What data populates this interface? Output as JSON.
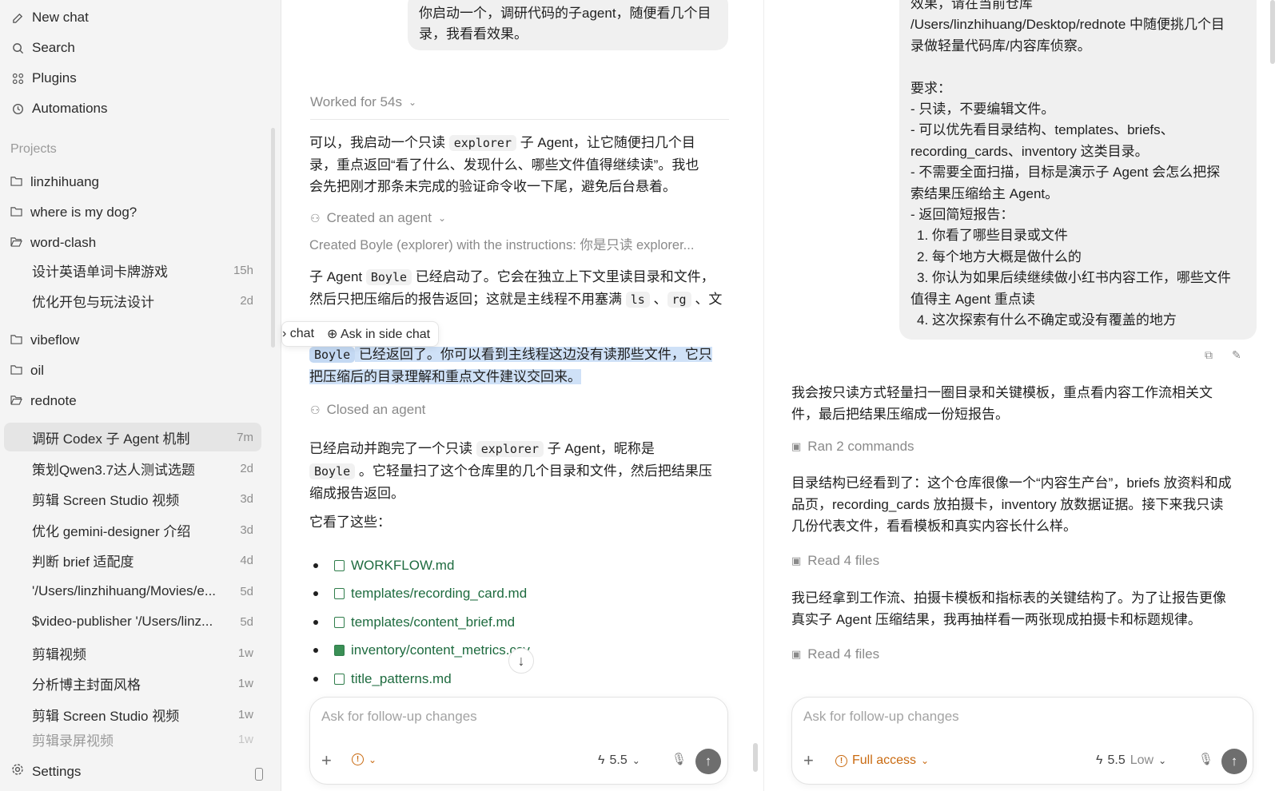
{
  "sidebar": {
    "nav": [
      {
        "label": "New chat",
        "icon": "compose-icon"
      },
      {
        "label": "Search",
        "icon": "search-icon"
      },
      {
        "label": "Plugins",
        "icon": "plugins-icon"
      },
      {
        "label": "Automations",
        "icon": "clock-icon"
      }
    ],
    "projects_label": "Projects",
    "projects": [
      "linzhihuang",
      "where is my dog?",
      "word-clash",
      "vibeflow",
      "oil",
      "rednote"
    ],
    "word_clash_threads": [
      {
        "title": "设计英语单词卡牌游戏",
        "age": "15h"
      },
      {
        "title": "优化开包与玩法设计",
        "age": "2d"
      }
    ],
    "rednote_threads": [
      {
        "title": "调研 Codex 子 Agent 机制",
        "age": "7m"
      },
      {
        "title": "策划Qwen3.7达人测试选题",
        "age": "2d"
      },
      {
        "title": "剪辑 Screen Studio 视频",
        "age": "3d"
      },
      {
        "title": "优化 gemini-designer 介绍",
        "age": "3d"
      },
      {
        "title": "判断 brief 适配度",
        "age": "4d"
      },
      {
        "title": "'/Users/linzhihuang/Movies/e...",
        "age": "5d"
      },
      {
        "title": "$video-publisher '/Users/linz...",
        "age": "5d"
      },
      {
        "title": "剪辑视频",
        "age": "1w"
      },
      {
        "title": "分析博主封面风格",
        "age": "1w"
      },
      {
        "title": "剪辑 Screen Studio 视频",
        "age": "1w"
      },
      {
        "title": "剪辑录屏视频",
        "age": "1w"
      }
    ],
    "settings_label": "Settings"
  },
  "middle": {
    "user_msg_line1": "你启动一个，调研代码的子agent，随便看几个目",
    "user_msg_line2": "录，我看看效果。",
    "worked": "Worked for 54s",
    "p1_a": "可以，我启动一个只读 ",
    "p1_code": "explorer",
    "p1_b": " 子 Agent，让它随便扫几个目",
    "p1_l2": "录，重点返回“看了什么、发现什么、哪些文件值得继续读”。我也",
    "p1_l3": "会先把刚才那条未完成的验证命令收一下尾，避免后台悬着。",
    "created_agent": "Created an agent",
    "created_detail": "Created Boyle (explorer) with the instructions: 你是只读 explorer...",
    "p2_a": "子 Agent ",
    "p2_code": "Boyle",
    "p2_b": " 已经启动了。它会在独立上下文里读目录和文件，",
    "p2_l2a": "然后只把压缩后的报告返回；这就是主线程不用塞满 ",
    "p2_code2": "ls",
    "p2_sep": " 、",
    "p2_code3": "rg",
    "p2_tail": " 、文",
    "popover_chat": "chat",
    "popover_side": "Ask in side chat",
    "p3_code": "Boyle",
    "p3_l1": " 已经返回了。你可以看到主线程这边没有读那些文件，它只",
    "p3_l2": "把压缩后的目录理解和重点文件建议交回来。",
    "closed_agent": "Closed an agent",
    "p4_a": "已经启动并跑完了一个只读 ",
    "p4_code": "explorer",
    "p4_b": " 子 Agent，昵称是",
    "p4_code2": "Boyle",
    "p4_l2": " 。它轻量扫了这个仓库里的几个目录和文件，然后把结果压",
    "p4_l3": "缩成报告返回。",
    "p5": "它看了这些：",
    "files": [
      "WORKFLOW.md",
      "templates/recording_card.md",
      "templates/content_brief.md",
      "inventory/content_metrics.csv",
      "title_patterns.md"
    ],
    "composer_placeholder": "Ask for follow-up changes",
    "model": "5.5"
  },
  "right": {
    "req_lines": [
      "效果，请在当前仓库",
      "/Users/linzhihuang/Desktop/rednote 中随便挑几个目",
      "录做轻量代码库/内容库侦察。",
      "",
      "要求：",
      "- 只读，不要编辑文件。",
      "- 可以优先看目录结构、templates、briefs、",
      "recording_cards、inventory 这类目录。",
      "- 不需要全面扫描，目标是演示子 Agent 会怎么把探",
      "索结果压缩给主 Agent。",
      "- 返回简短报告：",
      "  1. 你看了哪些目录或文件",
      "  2. 每个地方大概是做什么的",
      "  3. 你认为如果后续继续做小红书内容工作，哪些文件",
      "值得主 Agent 重点读",
      "  4. 这次探索有什么不确定或没有覆盖的地方"
    ],
    "r_p1_l1": "我会按只读方式轻量扫一圈目录和关键模板，重点看内容工作流相关文",
    "r_p1_l2": "件，最后把结果压缩成一份短报告。",
    "ran_commands": "Ran 2 commands",
    "r_p2_l1": "目录结构已经看到了：这个仓库很像一个“内容生产台”，briefs 放资料和成",
    "r_p2_l2": "品页，recording_cards 放拍摄卡，inventory 放数据证据。接下来我只读",
    "r_p2_l3": "几份代表文件，看看模板和真实内容长什么样。",
    "read_files_1": "Read 4 files",
    "r_p3_l1": "我已经拿到工作流、拍摄卡模板和指标表的关键结构了。为了让报告更像",
    "r_p3_l2": "真实子 Agent 压缩结果，我再抽样看一两张现成拍摄卡和标题规律。",
    "read_files_2": "Read 4 files",
    "composer_placeholder": "Ask for follow-up changes",
    "access": "Full access",
    "model": "5.5",
    "effort": "Low"
  }
}
